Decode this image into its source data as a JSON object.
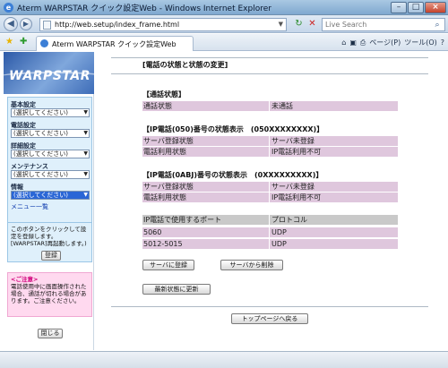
{
  "window": {
    "title": "Aterm WARPSTAR クイック設定Web - Windows Internet Explorer",
    "min": "–",
    "max": "□",
    "close": "×"
  },
  "nav": {
    "back": "◀",
    "forward": "▶",
    "url": "http://web.setup/index_frame.html",
    "search_placeholder": "Live Search",
    "search_icon": "magnifier-icon"
  },
  "tab": {
    "label": "Aterm WARPSTAR クイック設定Web"
  },
  "toolbar": {
    "page": "ページ(P)",
    "tools": "ツール(O)"
  },
  "sidebar": {
    "logo": "WARPSTAR",
    "menus": [
      {
        "label": "基本設定",
        "value": "(選択してください)"
      },
      {
        "label": "電話設定",
        "value": "(選択してください)"
      },
      {
        "label": "詳細設定",
        "value": "(選択してください)"
      },
      {
        "label": "メンテナンス",
        "value": "(選択してください)"
      },
      {
        "label": "情報",
        "value": "(選択してください)"
      }
    ],
    "menu_list_link": "メニュー一覧",
    "notice": "このボタンをクリックして設定を登録します。[WARPSTAR]再起動します。)",
    "register_button": "登録",
    "caution_title": "<ご注意>",
    "caution_text": "電話使用中に画面操作された場合、通話が切れる場合があります。ご注意ください。",
    "close_button": "閉じる"
  },
  "main": {
    "title": "[電話の状態と状態の変更]",
    "call_section": {
      "title": "【通話状態】",
      "rows": [
        {
          "label": "通話状態",
          "value": "未通話"
        }
      ]
    },
    "ip050_section": {
      "title": "【IP電話(050)番号の状態表示　(050XXXXXXXX)】",
      "rows": [
        {
          "label": "サーバ登録状態",
          "value": "サーバ未登録"
        },
        {
          "label": "電話利用状態",
          "value": "IP電話利用不可"
        }
      ]
    },
    "ip0abj_section": {
      "title": "【IP電話(0ABJ)番号の状態表示　(0XXXXXXXXX)】",
      "rows": [
        {
          "label": "サーバ登録状態",
          "value": "サーバ未登録"
        },
        {
          "label": "電話利用状態",
          "value": "IP電話利用不可"
        }
      ]
    },
    "port_table": {
      "headers": [
        "IP電話で使用するポート",
        "プロトコル"
      ],
      "rows": [
        {
          "port": "5060",
          "protocol": "UDP"
        },
        {
          "port": "5012-5015",
          "protocol": "UDP"
        }
      ]
    },
    "buttons": {
      "register": "サーバに登録",
      "delete": "サーバから削除",
      "refresh": "最新状態に更新",
      "top": "トップページへ戻る"
    }
  },
  "colors": {
    "row_pink": "#dfc7dd",
    "row_gray": "#c9c9c9",
    "sidebar_box": "#dff0fb",
    "caution_box": "#ffd9ef"
  }
}
